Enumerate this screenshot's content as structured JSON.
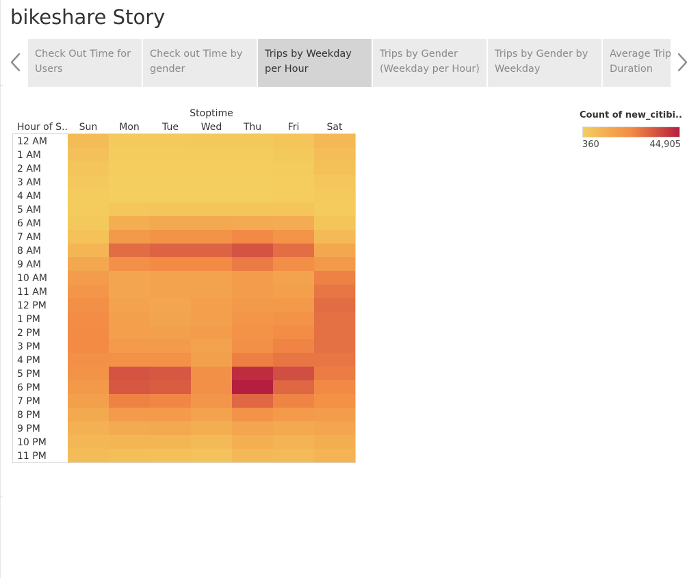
{
  "story": {
    "title": "bikeshare Story"
  },
  "nav": {
    "prev_icon": "chevron-left-icon",
    "next_icon": "chevron-right-icon"
  },
  "tabs": [
    {
      "label": "Check Out Time for\nUsers",
      "active": false
    },
    {
      "label": "Check out Time by\ngender",
      "active": false
    },
    {
      "label": "Trips by Weekday\nper Hour",
      "active": true
    },
    {
      "label": "Trips by Gender\n(Weekday per Hour)",
      "active": false
    },
    {
      "label": "Trips by Gender by\nWeekday",
      "active": false
    },
    {
      "label": "Average Trip\nDuration",
      "active": false
    }
  ],
  "legend": {
    "title": "Count of new_citibi..",
    "min_label": "360",
    "max_label": "44,905",
    "color_low": "#F4CE5E",
    "color_mid": "#F38B45",
    "color_high": "#B61E3F"
  },
  "chart_data": {
    "type": "heatmap",
    "column_header": "Stoptime",
    "row_header": "Hour of S..",
    "x_categories": [
      "Sun",
      "Mon",
      "Tue",
      "Wed",
      "Thu",
      "Fri",
      "Sat"
    ],
    "y_categories": [
      "12 AM",
      "1 AM",
      "2 AM",
      "3 AM",
      "4 AM",
      "5 AM",
      "6 AM",
      "7 AM",
      "8 AM",
      "9 AM",
      "10 AM",
      "11 AM",
      "12 PM",
      "1 PM",
      "2 PM",
      "3 PM",
      "4 PM",
      "5 PM",
      "6 PM",
      "7 PM",
      "8 PM",
      "9 PM",
      "10 PM",
      "11 PM"
    ],
    "color_range": [
      360,
      44905
    ],
    "values": [
      [
        6500,
        1800,
        1700,
        1900,
        2100,
        3300,
        7800
      ],
      [
        5000,
        1000,
        900,
        1000,
        1100,
        1900,
        6000
      ],
      [
        3500,
        700,
        600,
        700,
        700,
        1200,
        4600
      ],
      [
        2200,
        500,
        450,
        500,
        500,
        800,
        3000
      ],
      [
        1500,
        450,
        400,
        450,
        450,
        600,
        1800
      ],
      [
        1300,
        3000,
        3200,
        3300,
        3400,
        3200,
        1500
      ],
      [
        2000,
        11000,
        12500,
        12500,
        12300,
        11500,
        3500
      ],
      [
        4500,
        18000,
        20000,
        20000,
        23000,
        19500,
        7000
      ],
      [
        8500,
        29000,
        30500,
        30500,
        34000,
        28500,
        13000
      ],
      [
        13000,
        21000,
        22500,
        22500,
        26000,
        21500,
        18000
      ],
      [
        16500,
        13500,
        14500,
        14500,
        16500,
        14500,
        24500
      ],
      [
        19000,
        14000,
        14500,
        15000,
        17000,
        16000,
        27000
      ],
      [
        21000,
        15000,
        14000,
        16000,
        18000,
        18000,
        29000
      ],
      [
        22000,
        15500,
        14200,
        15500,
        19000,
        20000,
        28000
      ],
      [
        22500,
        16000,
        15500,
        16500,
        20000,
        22000,
        28000
      ],
      [
        22500,
        17500,
        17500,
        15000,
        21000,
        24000,
        28000
      ],
      [
        21000,
        20500,
        20500,
        15500,
        25000,
        27000,
        27000
      ],
      [
        20000,
        34000,
        33000,
        21000,
        42000,
        35000,
        25500
      ],
      [
        18000,
        33000,
        32000,
        21000,
        44905,
        30000,
        23000
      ],
      [
        15500,
        24500,
        23500,
        19000,
        30000,
        24000,
        20500
      ],
      [
        12500,
        17500,
        17500,
        15000,
        20000,
        17500,
        17000
      ],
      [
        10000,
        12000,
        12500,
        11000,
        14000,
        12500,
        13500
      ],
      [
        8000,
        8500,
        8500,
        7000,
        10500,
        9500,
        11000
      ],
      [
        6500,
        5500,
        5000,
        4300,
        7500,
        7000,
        9000
      ]
    ]
  }
}
